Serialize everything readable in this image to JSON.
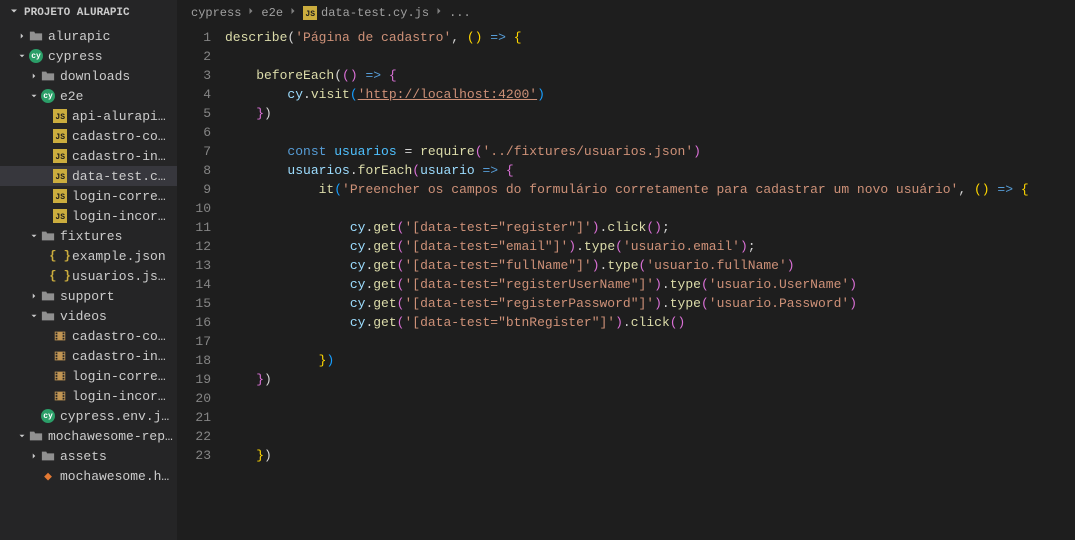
{
  "sidebar": {
    "title": "PROJETO ALURAPIC",
    "items": [
      {
        "label": "alurapic",
        "type": "folder-dark",
        "indent": 1,
        "expand": false
      },
      {
        "label": "cypress",
        "type": "cy-folder",
        "indent": 1,
        "expand": true
      },
      {
        "label": "downloads",
        "type": "folder-dark",
        "indent": 2,
        "expand": false
      },
      {
        "label": "e2e",
        "type": "cy-folder",
        "indent": 2,
        "expand": true
      },
      {
        "label": "api-alurapic.cy.js",
        "type": "js",
        "indent": 3
      },
      {
        "label": "cadastro-correto.s...",
        "type": "js",
        "indent": 3
      },
      {
        "label": "cadastro-incorreto....",
        "type": "js",
        "indent": 3
      },
      {
        "label": "data-test.cy.js",
        "type": "js",
        "indent": 3,
        "active": true
      },
      {
        "label": "login-correto.cy.js",
        "type": "js",
        "indent": 3
      },
      {
        "label": "login-incorreto.cy.js",
        "type": "js",
        "indent": 3
      },
      {
        "label": "fixtures",
        "type": "folder-dark",
        "indent": 2,
        "expand": true
      },
      {
        "label": "example.json",
        "type": "json",
        "indent": 3
      },
      {
        "label": "usuarios.json",
        "type": "json",
        "indent": 3
      },
      {
        "label": "support",
        "type": "folder-dark",
        "indent": 2,
        "expand": false
      },
      {
        "label": "videos",
        "type": "folder-dark",
        "indent": 2,
        "expand": true
      },
      {
        "label": "cadastro-correto.s...",
        "type": "video",
        "indent": 3
      },
      {
        "label": "cadastro-incorreto....",
        "type": "video",
        "indent": 3
      },
      {
        "label": "login-correto.cy.js....",
        "type": "video",
        "indent": 3
      },
      {
        "label": "login-incorreto.cy.j...",
        "type": "video",
        "indent": 3
      },
      {
        "label": "cypress.env.json",
        "type": "cy",
        "indent": 2
      },
      {
        "label": "mochawesome-report",
        "type": "folder-dark",
        "indent": 1,
        "expand": true
      },
      {
        "label": "assets",
        "type": "folder-dark",
        "indent": 2,
        "expand": false
      },
      {
        "label": "mochawesome.html",
        "type": "html",
        "indent": 2
      }
    ]
  },
  "breadcrumb": [
    "cypress",
    "e2e",
    "data-test.cy.js",
    "..."
  ],
  "lineCount": 23,
  "code": {
    "l1": {
      "fn": "describe",
      "str": "'Página de cadastro'"
    },
    "l3": {
      "fn": "beforeEach"
    },
    "l4": {
      "obj": "cy",
      "fn": "visit",
      "str": "'http://localhost:4200'"
    },
    "l7": {
      "kw": "const",
      "var": "usuarios",
      "fn": "require",
      "str": "'../fixtures/usuarios.json'"
    },
    "l8": {
      "obj": "usuarios",
      "fn": "forEach",
      "arg": "usuario"
    },
    "l9": {
      "fn": "it",
      "str": "'Preencher os campos do formulário corretamente para cadastrar um novo usuário'"
    },
    "l11": {
      "obj": "cy",
      "fn1": "get",
      "str": "'[data-test=\"register\"]'",
      "fn2": "click"
    },
    "l12": {
      "obj": "cy",
      "fn1": "get",
      "str1": "'[data-test=\"email\"]'",
      "fn2": "type",
      "str2": "'usuario.email'"
    },
    "l13": {
      "obj": "cy",
      "fn1": "get",
      "str1": "'[data-test=\"fullName\"]'",
      "fn2": "type",
      "str2": "'usuario.fullName'"
    },
    "l14": {
      "obj": "cy",
      "fn1": "get",
      "str1": "'[data-test=\"registerUserName\"]'",
      "fn2": "type",
      "str2": "'usuario.UserName'"
    },
    "l15": {
      "obj": "cy",
      "fn1": "get",
      "str1": "'[data-test=\"registerPassword\"]'",
      "fn2": "type",
      "str2": "'usuario.Password'"
    },
    "l16": {
      "obj": "cy",
      "fn1": "get",
      "str": "'[data-test=\"btnRegister\"]'",
      "fn2": "click"
    }
  }
}
